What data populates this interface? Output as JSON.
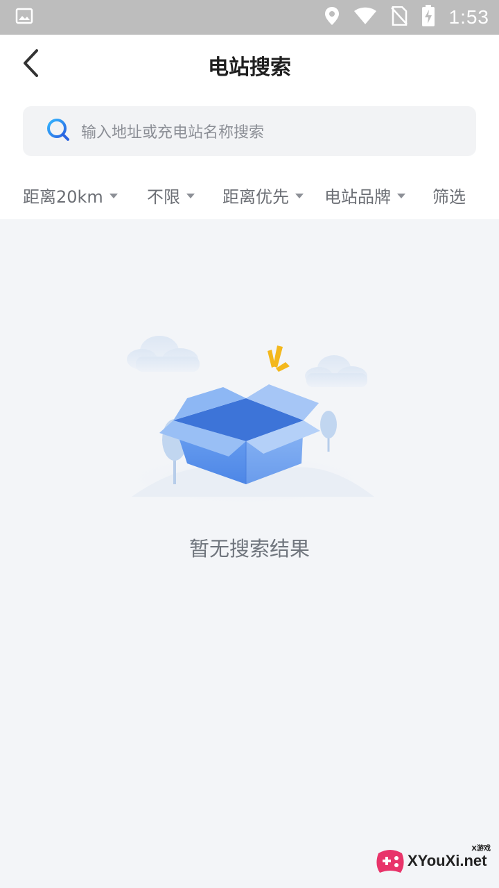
{
  "status_bar": {
    "time": "1:53",
    "icons": [
      "image-icon",
      "location-icon",
      "wifi-icon",
      "no-sim-icon",
      "battery-charging-icon"
    ]
  },
  "header": {
    "back_icon": "chevron-left-icon",
    "title": "电站搜索"
  },
  "search": {
    "icon": "search-icon",
    "placeholder": "输入地址或充电站名称搜索"
  },
  "filters": [
    {
      "label": "距离20km",
      "has_dropdown": true
    },
    {
      "label": "不限",
      "has_dropdown": true
    },
    {
      "label": "距离优先",
      "has_dropdown": true
    },
    {
      "label": "电站品牌",
      "has_dropdown": true
    },
    {
      "label": "筛选",
      "has_dropdown": false
    }
  ],
  "empty_state": {
    "icon": "empty-box-icon",
    "message": "暂无搜索结果"
  },
  "watermark": {
    "text": "XYouXi.net",
    "sub": "X游戏"
  },
  "colors": {
    "status_bar": "#bdbdbd",
    "page_background": "#f3f5f8",
    "accent_blue": "#2f7fe8",
    "box_blue": "#6b9ff0"
  }
}
